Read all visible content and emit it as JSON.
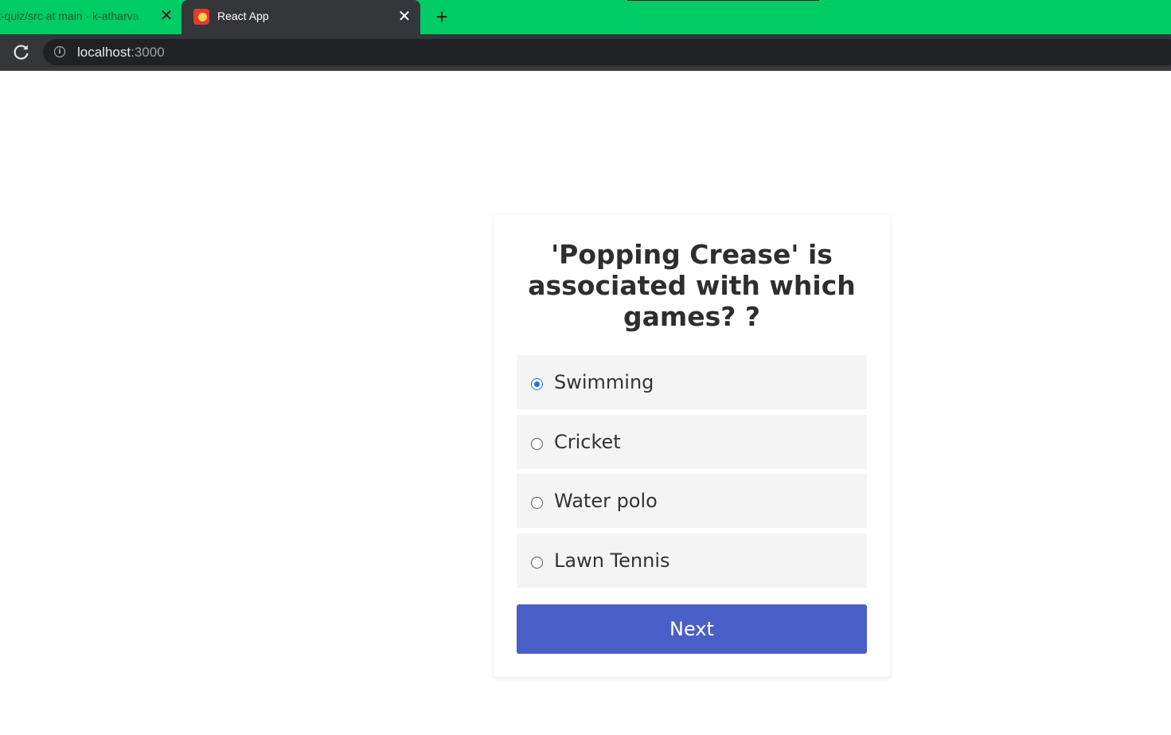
{
  "browser": {
    "tabs": [
      {
        "title": "t-quiz/src at main · k-atharva",
        "active": false
      },
      {
        "title": "React App",
        "active": true
      }
    ],
    "close_glyph": "✕",
    "new_tab_glyph": "+",
    "url_host": "localhost",
    "url_port": ":3000",
    "tabstrip_color": "#00cc66"
  },
  "quiz": {
    "question": "'Popping Crease' is associated with which games? ?",
    "options": [
      {
        "label": "Swimming",
        "selected": true
      },
      {
        "label": "Cricket",
        "selected": false
      },
      {
        "label": "Water polo",
        "selected": false
      },
      {
        "label": "Lawn Tennis",
        "selected": false
      }
    ],
    "next_label": "Next",
    "accent_color": "#4a5ec7"
  }
}
